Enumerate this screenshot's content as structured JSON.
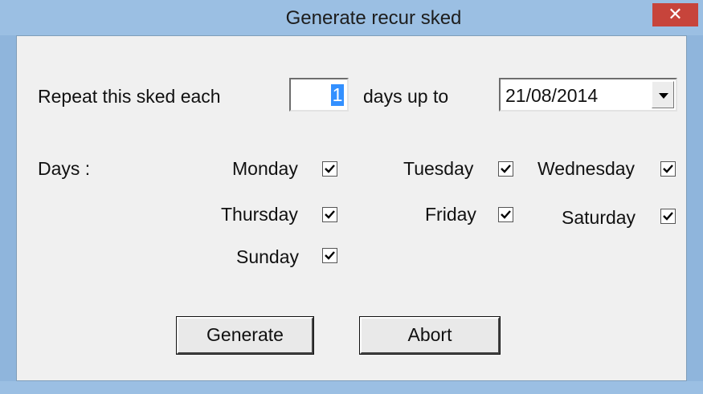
{
  "window": {
    "title": "Generate recur sked",
    "close_glyph": "✕"
  },
  "repeat": {
    "prefix_label": "Repeat this sked each",
    "interval_value": "1",
    "suffix_label": "days up to",
    "end_date": "21/08/2014"
  },
  "days": {
    "label": "Days :",
    "items": [
      {
        "name": "Monday",
        "checked": true
      },
      {
        "name": "Tuesday",
        "checked": true
      },
      {
        "name": "Wednesday",
        "checked": true
      },
      {
        "name": "Thursday",
        "checked": true
      },
      {
        "name": "Friday",
        "checked": true
      },
      {
        "name": "Saturday",
        "checked": true
      },
      {
        "name": "Sunday",
        "checked": true
      }
    ]
  },
  "buttons": {
    "generate_label": "Generate",
    "abort_label": "Abort"
  },
  "colors": {
    "title_bar": "#9bbfe3",
    "close_button": "#c7443b",
    "client_bg": "#f0f0f0",
    "selection": "#3390ff"
  }
}
